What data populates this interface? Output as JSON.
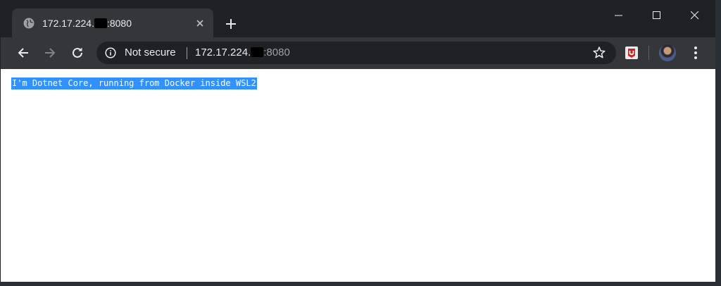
{
  "tab": {
    "title_prefix": "172.17.224.",
    "title_suffix": ":8080",
    "favicon": "globe-icon",
    "close_icon": "close-icon"
  },
  "newtab": {
    "label": "+"
  },
  "window_controls": [
    "minimize-icon",
    "maximize-icon",
    "close-icon"
  ],
  "toolbar": {
    "back_icon": "arrow-left-icon",
    "forward_icon": "arrow-right-icon",
    "reload_icon": "reload-icon"
  },
  "omnibox": {
    "security_label": "Not secure",
    "host_prefix": "172.17.224.",
    "port": ":8080",
    "bookmark_icon": "star-icon"
  },
  "page": {
    "text": "I'm Dotnet Core, running from Docker inside WSL2"
  },
  "colors": {
    "selection": "#3390ff",
    "chrome_dark": "#202124",
    "toolbar": "#35363a"
  }
}
